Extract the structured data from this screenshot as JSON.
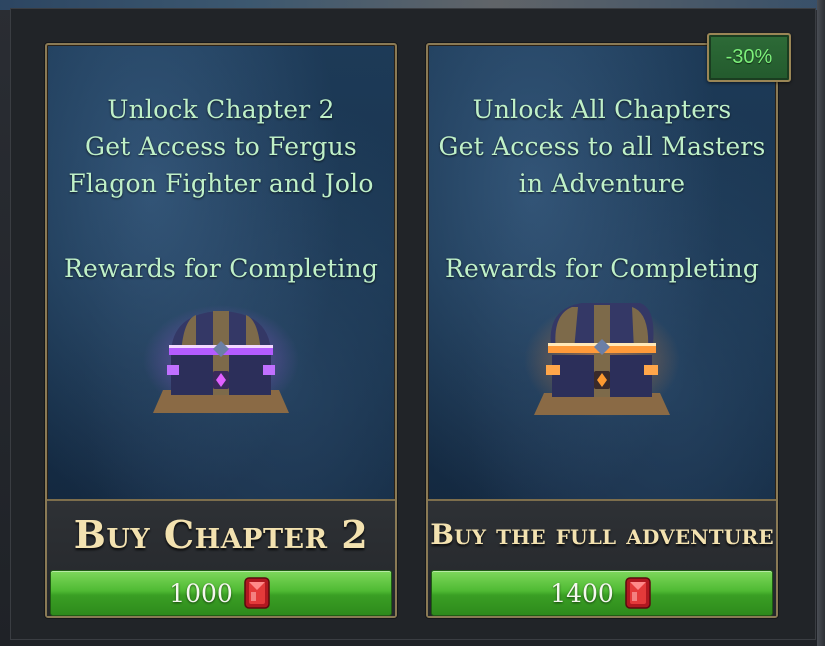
{
  "offers": [
    {
      "lines": [
        "Unlock Chapter 2",
        "Get Access to Fergus",
        "Flagon Fighter  and Jolo"
      ],
      "rewards_label": "Rewards for Completing",
      "chest_icon": "purple-treasure-chest-icon",
      "buy_title": "Buy Chapter 2",
      "price": "1000",
      "currency_icon": "red-gem-icon"
    },
    {
      "lines": [
        "Unlock All Chapters",
        "Get Access to all Masters",
        "in Adventure"
      ],
      "rewards_label": "Rewards for Completing",
      "chest_icon": "orange-treasure-chest-icon",
      "buy_title": "Buy the full adventure",
      "price": "1400",
      "currency_icon": "red-gem-icon",
      "discount": "-30%"
    }
  ],
  "colors": {
    "text_green": "#bff0c8",
    "title_gold": "#f3e2b0",
    "button_green": "#4fba33",
    "discount_text": "#7cf07a",
    "card_border": "#8a7a55"
  }
}
